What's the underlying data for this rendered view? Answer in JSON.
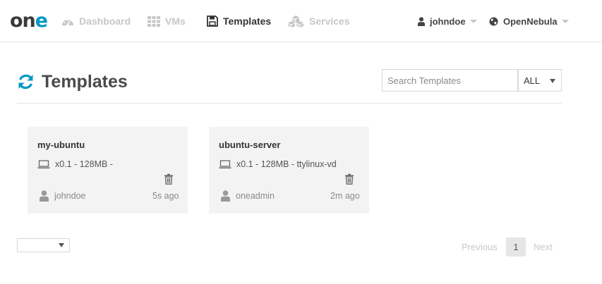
{
  "brand": {
    "logo_on": "on",
    "logo_e": "e"
  },
  "nav": {
    "items": [
      {
        "label": "Dashboard",
        "icon": "dashboard-icon",
        "active": false
      },
      {
        "label": "VMs",
        "icon": "grid-icon",
        "active": false
      },
      {
        "label": "Templates",
        "icon": "save-icon",
        "active": true
      },
      {
        "label": "Services",
        "icon": "cubes-icon",
        "active": false
      }
    ],
    "user": {
      "label": "johndoe",
      "icon": "user-icon"
    },
    "zone": {
      "label": "OpenNebula",
      "icon": "globe-icon"
    }
  },
  "header": {
    "title": "Templates",
    "refresh_icon": "refresh-icon",
    "search_placeholder": "Search Templates",
    "filter_value": "ALL"
  },
  "templates": [
    {
      "name": "my-ubuntu",
      "spec": "x0.1 - 128MB -",
      "owner": "johndoe",
      "time": "5s ago"
    },
    {
      "name": "ubuntu-server",
      "spec": "x0.1 - 128MB - ttylinux-vd",
      "owner": "oneadmin",
      "time": "2m ago"
    }
  ],
  "pagination": {
    "page_size": "",
    "previous": "Previous",
    "current": "1",
    "next": "Next"
  },
  "colors": {
    "accent": "#0098c3",
    "card_bg": "#f3f3f3",
    "muted": "#c7c7c7"
  }
}
